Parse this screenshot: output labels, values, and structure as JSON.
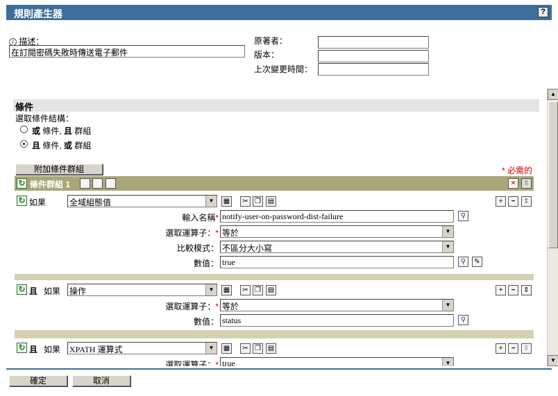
{
  "window": {
    "title": "規則產生器",
    "help_label": "?"
  },
  "meta": {
    "description_label": "描述：",
    "description_value": "在訂閱密碼失敗時傳送電子郵件",
    "author_label": "原著者：",
    "version_label": "版本：",
    "last_modified_label": "上次變更時間："
  },
  "conditions": {
    "header": "條件",
    "structure_label": "選取條件結構：",
    "option_or_prefix": "或",
    "option_or_middle": " 條件, ",
    "option_or_bold": "且",
    "option_or_suffix": " 群組",
    "option_and_prefix": "且",
    "option_and_middle": " 條件, ",
    "option_and_bold": "或",
    "option_and_suffix": " 群組",
    "selected_option": "and-conditions-or-groups",
    "add_group_label": "附加條件群組",
    "required_note": "* 必需的",
    "group_title": "條件群組 1"
  },
  "condition_rows": {
    "row1": {
      "if_label": "如果",
      "type_value": "全域組態值",
      "name_label": "輸入名稱",
      "name_value": "notify-user-on-password-dist-failure",
      "operator_label": "選取運算子：",
      "operator_value": "等於",
      "compare_label": "比較模式：",
      "compare_value": "不區分大小寫",
      "value_label": "數值：",
      "value_value": "true"
    },
    "row2": {
      "and_label": "且",
      "if_label": "如果",
      "type_value": "操作",
      "operator_label": "選取運算子：",
      "operator_value": "等於",
      "value_label": "數值：",
      "value_value": "status"
    },
    "row3": {
      "and_label": "且",
      "if_label": "如果",
      "type_value": "XPATH 運算式",
      "operator_label": "選取運算子：",
      "operator_value": "true"
    }
  },
  "footer": {
    "ok_label": "確定",
    "cancel_label": "取消"
  },
  "colors": {
    "accent": "#3e6f9c",
    "group_header": "#a8a779",
    "group_body": "#d3d2b1",
    "required": "#cc0000"
  }
}
